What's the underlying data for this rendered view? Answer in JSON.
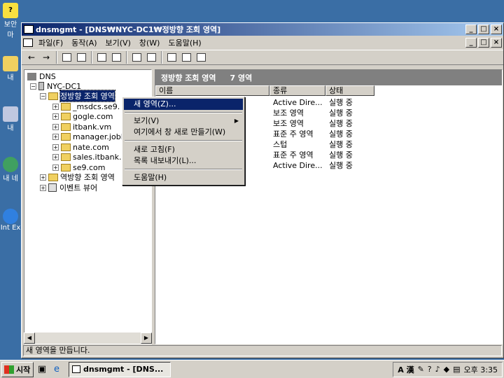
{
  "window": {
    "title": "dnsmgmt - [DNS₩NYC-DC1₩정방향 조회 영역]"
  },
  "desktop_icons": [
    {
      "label": "보안 마"
    },
    {
      "label": "내"
    },
    {
      "label": "내 "
    },
    {
      "label": "내 네"
    },
    {
      "label": "Int Ex"
    }
  ],
  "menu": [
    "파일(F)",
    "동작(A)",
    "보기(V)",
    "창(W)",
    "도움말(H)"
  ],
  "tree": {
    "root": "DNS",
    "server": "NYC-DC1",
    "forward": "정방향 조회 영역",
    "zones": [
      "_msdcs.se9.",
      "gogle.com",
      "itbank.vm",
      "manager.jobl",
      "nate.com",
      "sales.itbank.",
      "se9.com"
    ],
    "reverse": "역방향 조회 영역",
    "events": "이벤트 뷰어"
  },
  "right_pane": {
    "header": "정방향 조회 영역",
    "count": "7 영역",
    "columns": [
      "이름",
      "종류",
      "상태"
    ],
    "rows": [
      {
        "type": "Active Dire...",
        "status": "실행 중"
      },
      {
        "type": "보조 영역",
        "status": "실행 중"
      },
      {
        "type": "보조 영역",
        "status": "실행 중"
      },
      {
        "type": "표준 주 영역",
        "status": "실행 중"
      },
      {
        "type": "스텁",
        "status": "실행 중"
      },
      {
        "type": "표준 주 영역",
        "status": "실행 중"
      },
      {
        "type": "Active Dire...",
        "status": "실행 중"
      }
    ]
  },
  "context_menu": {
    "new_zone": "새 영역(Z)...",
    "view": "보기(V)",
    "new_window": "여기에서 창 새로 만들기(W)",
    "refresh": "새로 고침(F)",
    "export": "목록 내보내기(L)...",
    "help": "도움말(H)"
  },
  "status": "새 영역을 만듭니다.",
  "taskbar": {
    "start": "시작",
    "task": "dnsmgmt - [DNS...",
    "clock": "오후 3:35",
    "ime": "A 漢"
  },
  "colors": {
    "desktop": "#3a6ea5",
    "titlebar": "#0a246a",
    "face": "#d4d0c8"
  }
}
